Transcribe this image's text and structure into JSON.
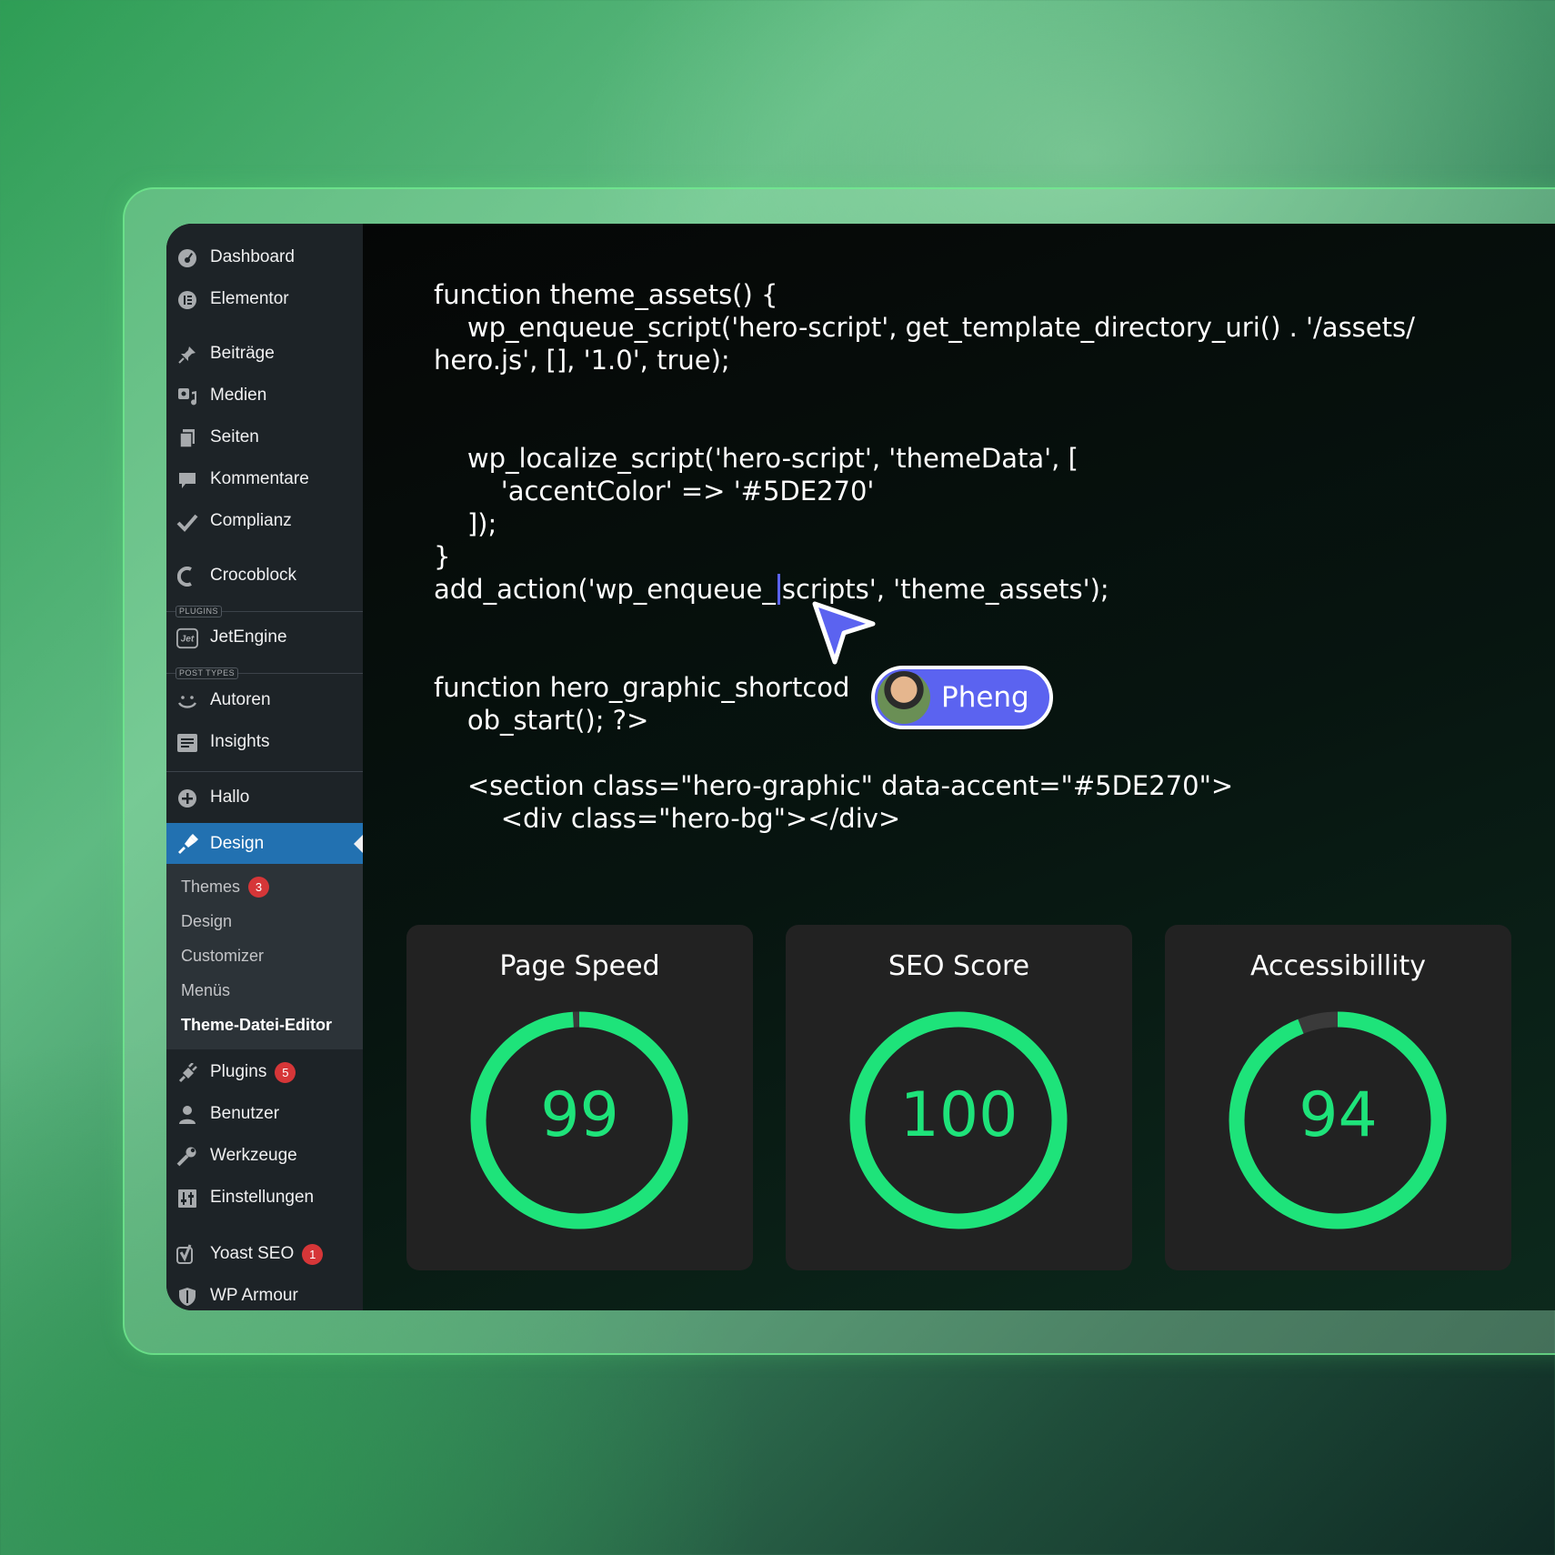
{
  "sidebar": {
    "items": [
      {
        "label": "Dashboard",
        "icon": "gauge-icon"
      },
      {
        "label": "Elementor",
        "icon": "elementor-icon"
      },
      {
        "label": "Beiträge",
        "icon": "pin-icon"
      },
      {
        "label": "Medien",
        "icon": "media-icon"
      },
      {
        "label": "Seiten",
        "icon": "page-icon"
      },
      {
        "label": "Kommentare",
        "icon": "comment-icon"
      },
      {
        "label": "Complianz",
        "icon": "check-icon"
      },
      {
        "label": "Crocoblock",
        "icon": "crocoblock-icon"
      },
      {
        "label": "JetEngine",
        "icon": "jet-icon"
      },
      {
        "label": "Autoren",
        "icon": "smile-icon"
      },
      {
        "label": "Insights",
        "icon": "list-icon"
      },
      {
        "label": "Hallo",
        "icon": "plus-circle-icon"
      },
      {
        "label": "Design",
        "icon": "brush-icon"
      },
      {
        "label": "Plugins",
        "icon": "plug-icon",
        "badge": "5"
      },
      {
        "label": "Benutzer",
        "icon": "user-icon"
      },
      {
        "label": "Werkzeuge",
        "icon": "wrench-icon"
      },
      {
        "label": "Einstellungen",
        "icon": "settings-icon"
      },
      {
        "label": "Yoast SEO",
        "icon": "yoast-icon",
        "badge": "1"
      },
      {
        "label": "WP Armour",
        "icon": "shield-icon"
      }
    ],
    "section_plugins": "PLUGINS",
    "section_post_types": "POST TYPES",
    "submenu": [
      {
        "label": "Themes",
        "badge": "3"
      },
      {
        "label": "Design"
      },
      {
        "label": "Customizer"
      },
      {
        "label": "Menüs"
      },
      {
        "label": "Theme-Datei-Editor"
      }
    ],
    "accent_color": "#2271b1",
    "badge_color": "#d63638"
  },
  "code": {
    "lines": [
      "function theme_assets() {",
      "    wp_enqueue_script('hero-script', get_template_directory_uri() . '/assets/",
      "hero.js', [], '1.0', true);",
      "    wp_localize_script('hero-script', 'themeData', [",
      "        'accentColor' => '#5DE270'",
      "    ]);",
      "}",
      "add_action('wp_enqueue_",
      "scripts', 'theme_assets');",
      "function hero_graphic_shortcod",
      "    ob_start(); ?>",
      "    <section class=\"hero-graphic\" data-accent=\"#5DE270\">",
      "        <div class=\"hero-bg\"></div>"
    ]
  },
  "collaborator": {
    "name": "Pheng",
    "color": "#5b63f0"
  },
  "scores": [
    {
      "title": "Page Speed",
      "value": 99
    },
    {
      "title": "SEO Score",
      "value": 100
    },
    {
      "title": "Accessibillity",
      "value": 94
    }
  ],
  "score_color": "#1ee37a"
}
